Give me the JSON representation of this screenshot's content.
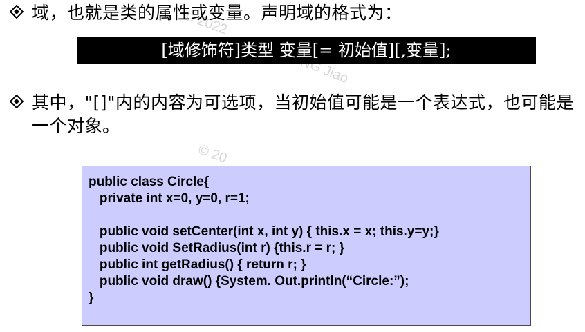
{
  "bullet1": {
    "text": "域，也就是类的属性或变量。声明域的格式为："
  },
  "syntax": {
    "text": "[域修饰符]类型 变量[= 初始值][,变量];"
  },
  "bullet2": {
    "text": "其中，\"[]\"内的内容为可选项，当初始值可能是一个表达式，也可能是一个对象。"
  },
  "code": {
    "lines": [
      "public class Circle{",
      "   private int x=0, y=0, r=1;",
      "",
      "   public void setCenter(int x, int y) { this.x = x; this.y=y;}",
      "   public void SetRadius(int r) {this.r = r; }",
      "   public int getRadius() { return r; }",
      "   public void draw() {System. Out.println(“Circle:”);",
      "}"
    ]
  },
  "watermark": {
    "mark1": "© 2022",
    "mark2": "ANG Jiao",
    "mark3": "© 20"
  },
  "colors": {
    "code_bg": "#ccccfe",
    "syntax_bg": "#000000"
  }
}
